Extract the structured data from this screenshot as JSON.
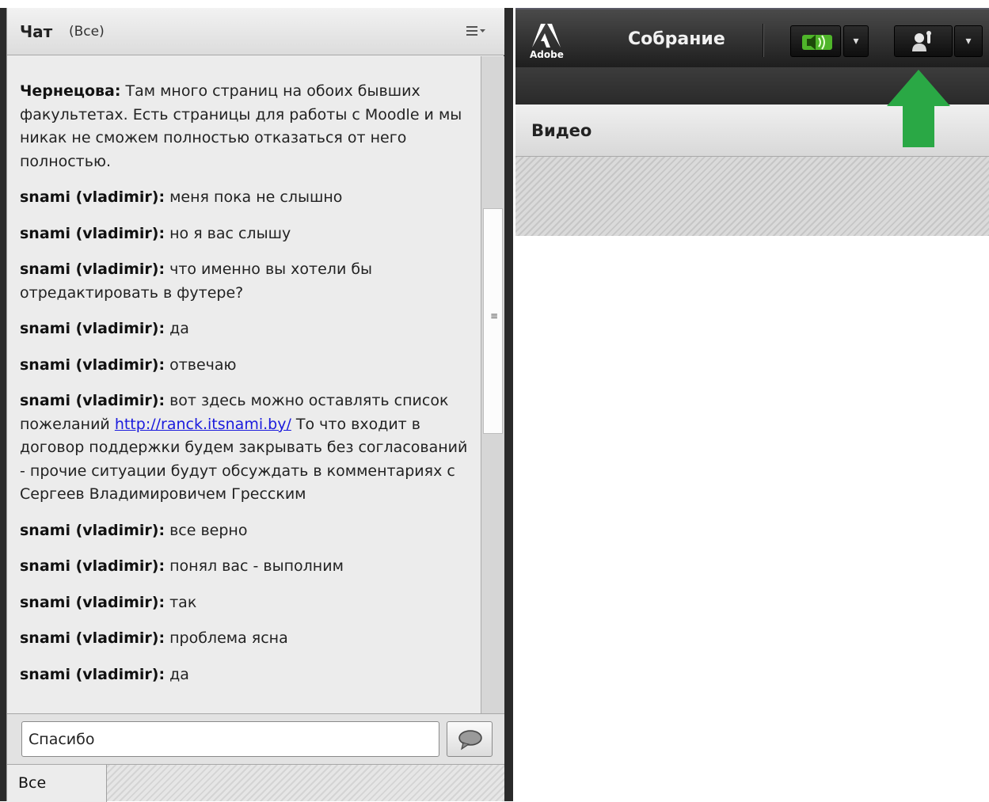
{
  "chat": {
    "title": "Чат",
    "filter": "(Все)",
    "messages": [
      {
        "author": "Чернецова:",
        "text": " Там много страниц на обоих бывших факультетах. Есть страницы  для работы с Moodle и мы никак не сможем полностью отказаться от него полностью."
      },
      {
        "author": "snami (vladimir):",
        "text": " меня пока не слышно"
      },
      {
        "author": "snami (vladimir):",
        "text": " но я вас слышу"
      },
      {
        "author": "snami (vladimir):",
        "text": " что именно вы хотели бы отредактировать в футере?"
      },
      {
        "author": "snami (vladimir):",
        "text": " да"
      },
      {
        "author": "snami (vladimir):",
        "text": " отвечаю"
      },
      {
        "author": "snami (vladimir):",
        "text_before": " вот здесь можно оставлять список пожеланий ",
        "link": "http://ranck.itsnami.by/",
        "text_after": " То что входит в договор поддержки будем закрывать без согласований - прочие ситуации будут обсуждать в комментариях с Сергеев Владимировичем Гресским"
      },
      {
        "author": "snami (vladimir):",
        "text": " все верно"
      },
      {
        "author": "snami (vladimir):",
        "text": " понял вас - выполним"
      },
      {
        "author": "snami (vladimir):",
        "text": " так"
      },
      {
        "author": "snami (vladimir):",
        "text": " проблема ясна"
      },
      {
        "author": "snami (vladimir):",
        "text": " да"
      }
    ],
    "input_value": "Спасибо",
    "recipient": "Все",
    "scroll_grip": "≡"
  },
  "meeting": {
    "brand": "Adobe",
    "title": "Собрание",
    "video_title": "Видео",
    "dropdown_glyph": "▾"
  },
  "icons": {
    "menu": "list-menu-icon",
    "send": "speech-bubble-icon",
    "audio": "speaker-icon",
    "status": "raise-hand-icon",
    "arrow": "up-arrow-icon"
  },
  "colors": {
    "accent_green": "#2aa845",
    "speaker_green": "#6fd33a",
    "link_blue": "#1a1add"
  }
}
